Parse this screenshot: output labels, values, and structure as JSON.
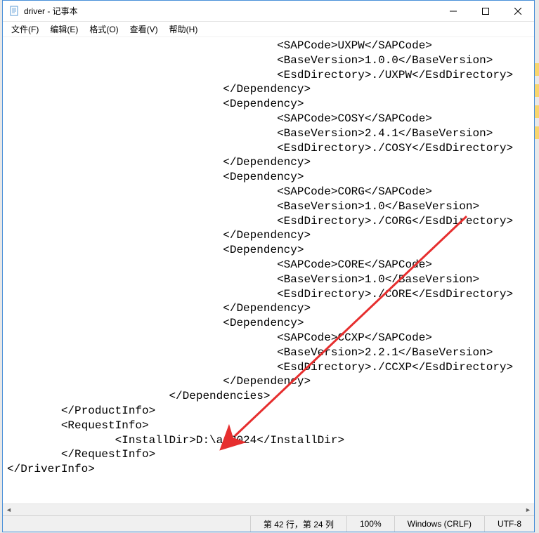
{
  "window": {
    "title": "driver - 记事本"
  },
  "menu": {
    "file": "文件(F)",
    "edit": "编辑(E)",
    "format": "格式(O)",
    "view": "查看(V)",
    "help": "帮助(H)"
  },
  "content": {
    "text": "                                        <SAPCode>UXPW</SAPCode>\n                                        <BaseVersion>1.0.0</BaseVersion>\n                                        <EsdDirectory>./UXPW</EsdDirectory>\n                                </Dependency>\n                                <Dependency>\n                                        <SAPCode>COSY</SAPCode>\n                                        <BaseVersion>2.4.1</BaseVersion>\n                                        <EsdDirectory>./COSY</EsdDirectory>\n                                </Dependency>\n                                <Dependency>\n                                        <SAPCode>CORG</SAPCode>\n                                        <BaseVersion>1.0</BaseVersion>\n                                        <EsdDirectory>./CORG</EsdDirectory>\n                                </Dependency>\n                                <Dependency>\n                                        <SAPCode>CORE</SAPCode>\n                                        <BaseVersion>1.0</BaseVersion>\n                                        <EsdDirectory>./CORE</EsdDirectory>\n                                </Dependency>\n                                <Dependency>\n                                        <SAPCode>CCXP</SAPCode>\n                                        <BaseVersion>2.2.1</BaseVersion>\n                                        <EsdDirectory>./CCXP</EsdDirectory>\n                                </Dependency>\n                        </Dependencies>\n        </ProductInfo>\n        <RequestInfo>\n                <InstallDir>D:\\ai2024</InstallDir>\n        </RequestInfo>\n</DriverInfo>"
  },
  "status": {
    "position": "第 42 行，第 24 列",
    "zoom": "100%",
    "lineending": "Windows (CRLF)",
    "encoding": "UTF-8"
  }
}
